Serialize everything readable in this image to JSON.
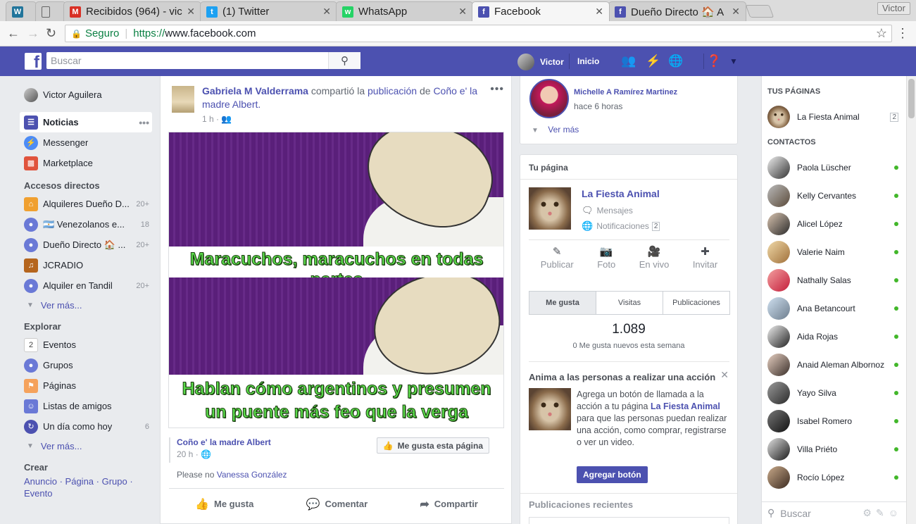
{
  "browser": {
    "tabs": [
      {
        "label": "",
        "icon": "wordpress-icon",
        "color": "#21759b"
      },
      {
        "label": "",
        "icon": "document-icon",
        "color": "#888888"
      },
      {
        "label": "Recibidos (964) - vic",
        "icon": "gmail-icon",
        "color": "#d93025"
      },
      {
        "label": "(1) Twitter",
        "icon": "twitter-icon",
        "color": "#1da1f2"
      },
      {
        "label": "WhatsApp",
        "icon": "whatsapp-icon",
        "color": "#25d366"
      },
      {
        "label": "Facebook",
        "icon": "facebook-icon",
        "color": "#4c51b0"
      },
      {
        "label": "Dueño Directo 🏠 A",
        "icon": "facebook-icon",
        "color": "#4c51b0"
      }
    ],
    "profile_name": "Victor",
    "secure_label": "Seguro",
    "url_protocol": "https://",
    "url_host": "www.facebook.com"
  },
  "header": {
    "search_placeholder": "Buscar",
    "user_name": "Victor",
    "home_label": "Inicio",
    "brand_color": "#4c51b0"
  },
  "left_nav": {
    "user": "Victor Aguilera",
    "main": [
      {
        "label": "Noticias",
        "icon": "news-feed-icon"
      },
      {
        "label": "Messenger",
        "icon": "messenger-icon"
      },
      {
        "label": "Marketplace",
        "icon": "marketplace-icon"
      }
    ],
    "shortcuts_title": "Accesos directos",
    "shortcuts": [
      {
        "label": "Alquileres Dueño D...",
        "count": "20+",
        "icon": "house-icon"
      },
      {
        "label": "🇦🇷 Venezolanos e...",
        "count": "18",
        "icon": "group-icon"
      },
      {
        "label": "Dueño Directo 🏠 ...",
        "count": "20+",
        "icon": "group-icon"
      },
      {
        "label": "JCRADIO",
        "count": "",
        "icon": "guitar-icon"
      },
      {
        "label": "Alquiler en Tandil",
        "count": "20+",
        "icon": "group-icon"
      }
    ],
    "see_more": "Ver más...",
    "explore_title": "Explorar",
    "explore": [
      {
        "label": "Eventos",
        "count": "",
        "icon": "calendar-icon"
      },
      {
        "label": "Grupos",
        "count": "",
        "icon": "group-icon"
      },
      {
        "label": "Páginas",
        "count": "",
        "icon": "flag-icon"
      },
      {
        "label": "Listas de amigos",
        "count": "",
        "icon": "friends-list-icon"
      },
      {
        "label": "Un día como hoy",
        "count": "6",
        "icon": "memories-icon"
      }
    ],
    "create_title": "Crear",
    "create_links": [
      "Anuncio",
      "Página",
      "Grupo",
      "Evento"
    ]
  },
  "post": {
    "author": "Gabriela M Valderrama",
    "shared_text": "compartió la",
    "publication_link": "publicación",
    "of_text": "de",
    "source_page": "Coño e' la madre Albert.",
    "time": "1 h ·",
    "caption_top": "Maracuchos, maracuchos en todas partes",
    "caption_bottom_1": "Hablan cómo argentinos y presumen",
    "caption_bottom_2": "un puente más feo que la verga",
    "shared_from": "Coño e' la madre Albert",
    "shared_time": "20 h ·",
    "like_page_label": "Me gusta esta página",
    "please_text": "Please no",
    "please_link": "Vanessa González",
    "actions": [
      "Me gusta",
      "Comentar",
      "Compartir"
    ]
  },
  "right_col": {
    "person_name": "Michelle A Ramírez Martinez",
    "person_time": "hace 6 horas",
    "see_more": "Ver más",
    "your_page_title": "Tu página",
    "page_name": "La Fiesta Animal",
    "messages_label": "Mensajes",
    "notifications_label": "Notificaciones",
    "notifications_count": "2",
    "page_actions": [
      {
        "label": "Publicar",
        "icon": "edit-icon"
      },
      {
        "label": "Foto",
        "icon": "camera-icon"
      },
      {
        "label": "En vivo",
        "icon": "live-video-icon"
      },
      {
        "label": "Invitar",
        "icon": "invite-icon"
      }
    ],
    "tabs": [
      "Me gusta",
      "Visitas",
      "Publicaciones"
    ],
    "likes_count": "1.089",
    "likes_sub": "0 Me gusta nuevos esta semana",
    "cta_title": "Anima a las personas a realizar una acción",
    "cta_text_1": "Agrega un botón de llamada a la acción a tu página",
    "cta_text_link": "La Fiesta Animal",
    "cta_text_2": "para que las personas puedan realizar una acción, como comprar, registrarse o ver un video.",
    "cta_button": "Agregar botón",
    "recent_title": "Publicaciones recientes"
  },
  "sidebar": {
    "pages_title": "TUS PÁGINAS",
    "page_name": "La Fiesta Animal",
    "page_count": "2",
    "contacts_title": "CONTACTOS",
    "contacts": [
      "Paola Lüscher",
      "Kelly Cervantes",
      "Alicel López",
      "Valerie Naim",
      "Nathally Salas",
      "Ana Betancourt",
      "Aida Rojas",
      "Anaid Aleman Albornoz",
      "Yayo Silva",
      "Isabel Romero",
      "Villa Priéto",
      "Rocío López"
    ],
    "search_placeholder": "Buscar"
  }
}
